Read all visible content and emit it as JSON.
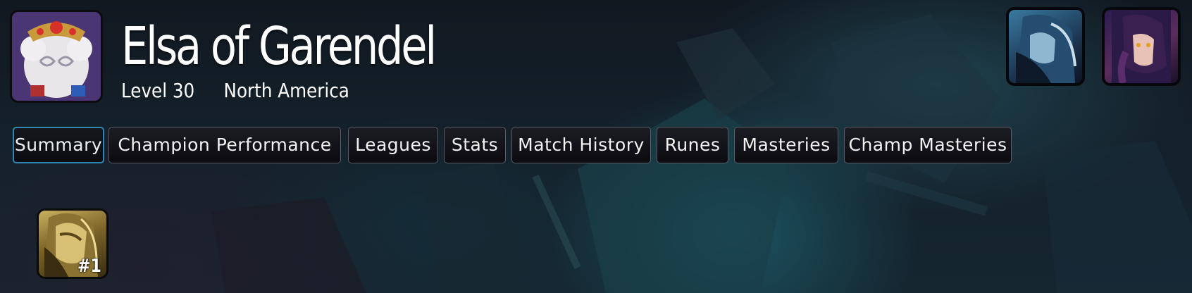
{
  "profile": {
    "summoner_name": "Elsa of Garendel",
    "level": "Level 30",
    "region": "North America"
  },
  "tabs": [
    {
      "label": "Summary",
      "active": true
    },
    {
      "label": "Champion Performance",
      "active": false
    },
    {
      "label": "Leagues",
      "active": false
    },
    {
      "label": "Stats",
      "active": false
    },
    {
      "label": "Match History",
      "active": false
    },
    {
      "label": "Runes",
      "active": false
    },
    {
      "label": "Masteries",
      "active": false
    },
    {
      "label": "Champ Masteries",
      "active": false
    }
  ],
  "top_mastery": {
    "rank": "#1"
  },
  "colors": {
    "active_tab_border": "#2d86b4",
    "tab_border": "#5a5d66",
    "text": "#ffffff"
  }
}
